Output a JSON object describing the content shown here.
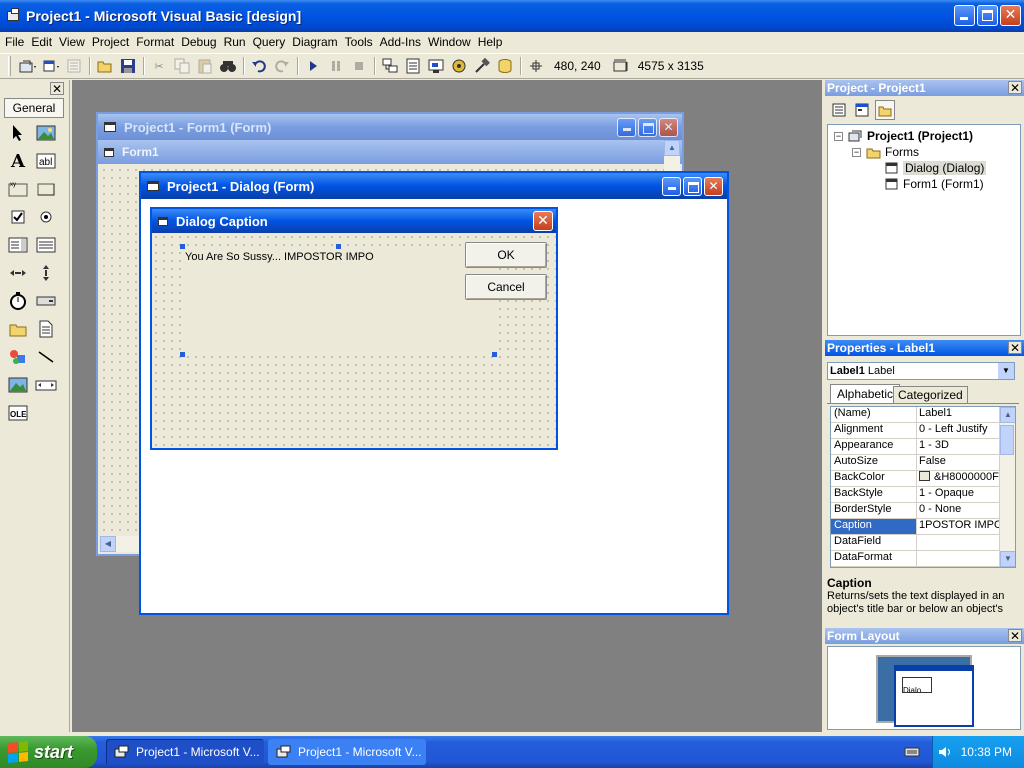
{
  "app": {
    "title": "Project1 - Microsoft Visual Basic [design]"
  },
  "menu": [
    "File",
    "Edit",
    "View",
    "Project",
    "Format",
    "Debug",
    "Run",
    "Query",
    "Diagram",
    "Tools",
    "Add-Ins",
    "Window",
    "Help"
  ],
  "toolbar": {
    "position": "480, 240",
    "size": "4575 x 3135"
  },
  "toolbox": {
    "tab": "General"
  },
  "form1": {
    "title": "Project1 - Form1 (Form)",
    "inner_caption": "Form1"
  },
  "dialog_form": {
    "title": "Project1 - Dialog (Form)"
  },
  "dialog": {
    "caption": "Dialog Caption",
    "label": "You Are So Sussy... IMPOSTOR IMPO",
    "ok": "OK",
    "cancel": "Cancel"
  },
  "project": {
    "title": "Project - Project1",
    "root": "Project1 (Project1)",
    "folder": "Forms",
    "items": [
      "Dialog (Dialog)",
      "Form1 (Form1)"
    ]
  },
  "properties": {
    "title": "Properties - Label1",
    "object": "Label1",
    "object_type": "Label",
    "tabs": [
      "Alphabetic",
      "Categorized"
    ],
    "rows": [
      {
        "name": "(Name)",
        "value": "Label1"
      },
      {
        "name": "Alignment",
        "value": "0 - Left Justify"
      },
      {
        "name": "Appearance",
        "value": "1 - 3D"
      },
      {
        "name": "AutoSize",
        "value": "False"
      },
      {
        "name": "BackColor",
        "value": "&H8000000F"
      },
      {
        "name": "BackStyle",
        "value": "1 - Opaque"
      },
      {
        "name": "BorderStyle",
        "value": "0 - None"
      },
      {
        "name": "Caption",
        "value": "1POSTOR IMPO"
      },
      {
        "name": "DataField",
        "value": ""
      },
      {
        "name": "DataFormat",
        "value": ""
      }
    ],
    "desc_title": "Caption",
    "desc_text": "Returns/sets the text displayed in an object's title bar or below an object's"
  },
  "form_layout": {
    "title": "Form Layout",
    "preview_label": "Dialo"
  },
  "taskbar": {
    "start": "start",
    "tasks": [
      "Project1 - Microsoft V...",
      "Project1 - Microsoft V..."
    ],
    "clock": "10:38 PM"
  }
}
